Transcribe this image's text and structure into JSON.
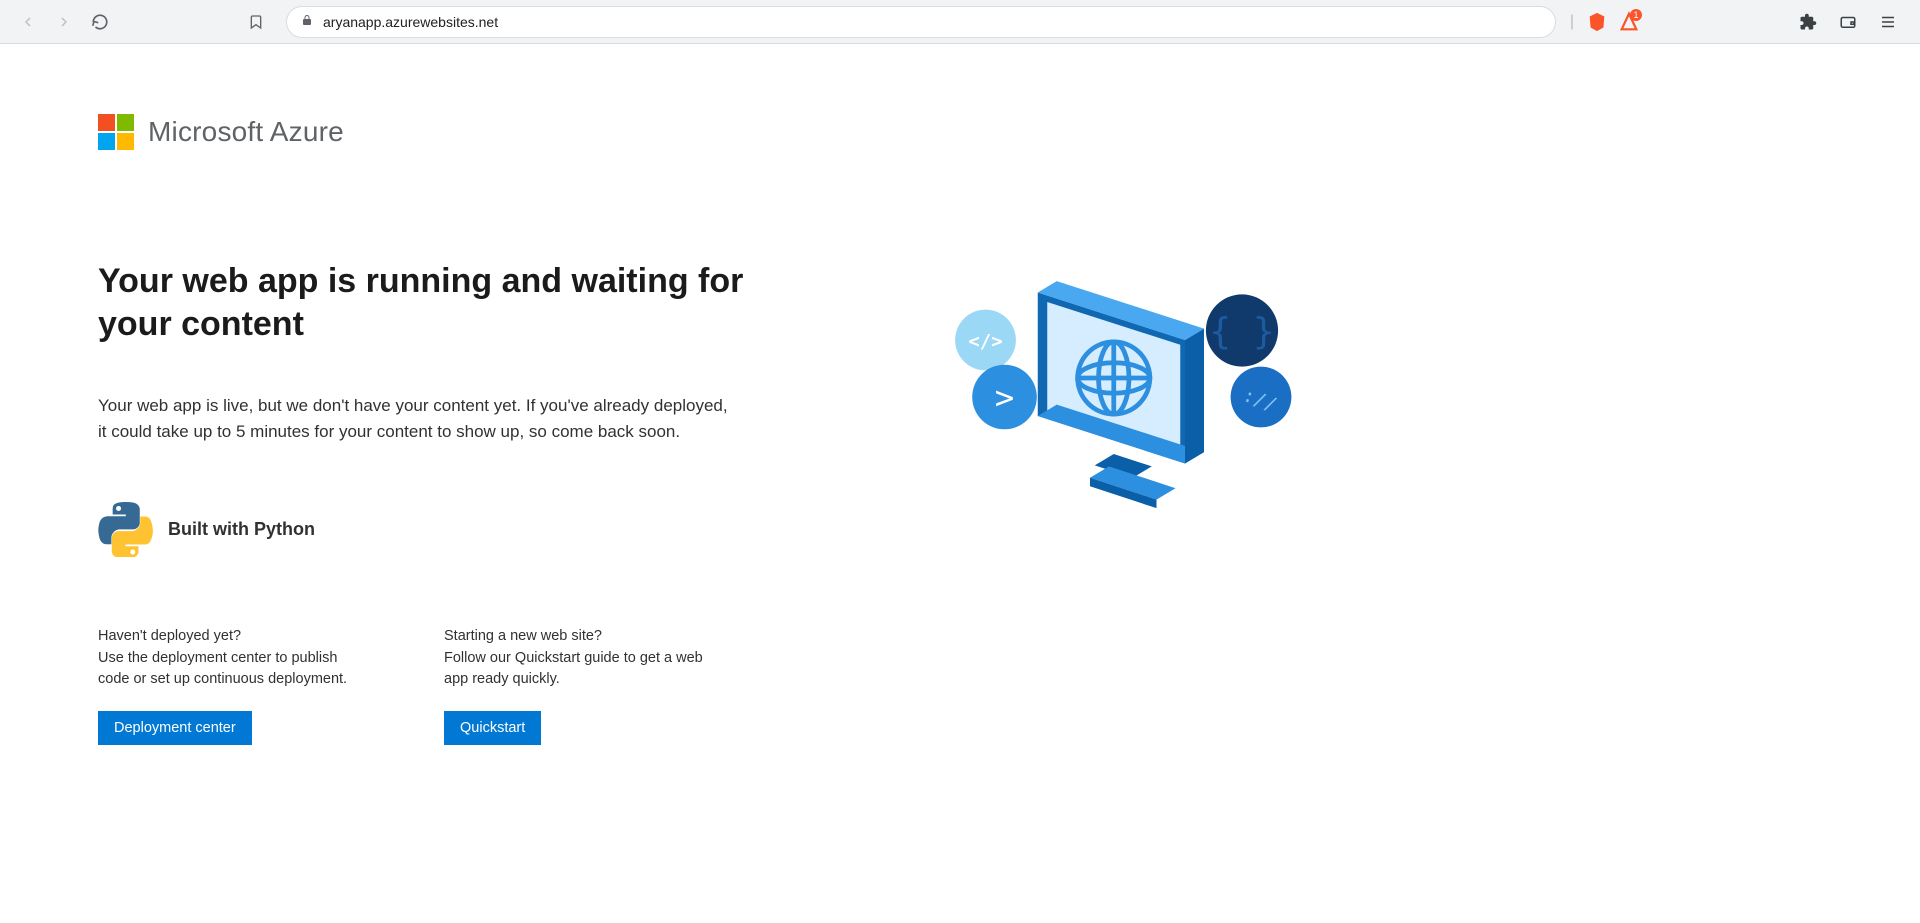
{
  "browser": {
    "url": "aryanapp.azurewebsites.net",
    "shield_badge": "1"
  },
  "header": {
    "brand": "Microsoft Azure"
  },
  "main": {
    "title": "Your web app is running and waiting for your content",
    "paragraph": "Your web app is live, but we don't have your content yet. If you've already deployed, it could take up to 5 minutes for your content to show up, so come back soon.",
    "built_label": "Built with Python"
  },
  "cta": {
    "deploy": {
      "q": "Haven't deployed yet?",
      "p": "Use the deployment center to publish code or set up continuous deployment.",
      "button": "Deployment center"
    },
    "quickstart": {
      "q": "Starting a new web site?",
      "p": "Follow our Quickstart guide to get a web app ready quickly.",
      "button": "Quickstart"
    }
  }
}
